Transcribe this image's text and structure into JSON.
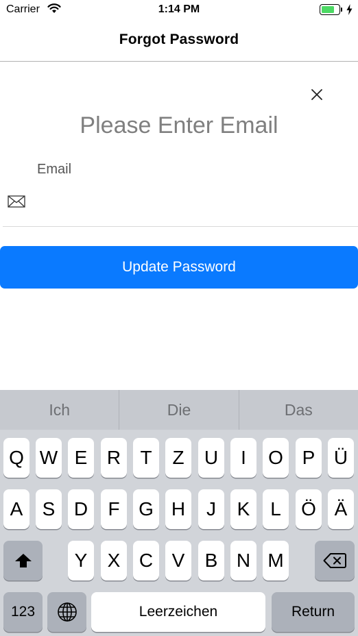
{
  "status_bar": {
    "carrier": "Carrier",
    "time": "1:14 PM",
    "battery_level": 0.75,
    "battery_color": "#4cd964"
  },
  "nav": {
    "title": "Forgot Password"
  },
  "form": {
    "close_icon": "close-icon",
    "heading": "Please Enter Email",
    "email_label": "Email",
    "email_value": "",
    "mail_icon": "envelope-icon",
    "submit_label": "Update Password",
    "accent_color": "#0a7aff"
  },
  "keyboard": {
    "suggestions": [
      "Ich",
      "Die",
      "Das"
    ],
    "row1": [
      "Q",
      "W",
      "E",
      "R",
      "T",
      "Z",
      "U",
      "I",
      "O",
      "P",
      "Ü"
    ],
    "row2": [
      "A",
      "S",
      "D",
      "F",
      "G",
      "H",
      "J",
      "K",
      "L",
      "Ö",
      "Ä"
    ],
    "row3": [
      "Y",
      "X",
      "C",
      "V",
      "B",
      "N",
      "M"
    ],
    "shift_icon": "shift-icon",
    "delete_icon": "backspace-icon",
    "numbers_label": "123",
    "globe_icon": "globe-icon",
    "space_label": "Leerzeichen",
    "return_label": "Return"
  }
}
